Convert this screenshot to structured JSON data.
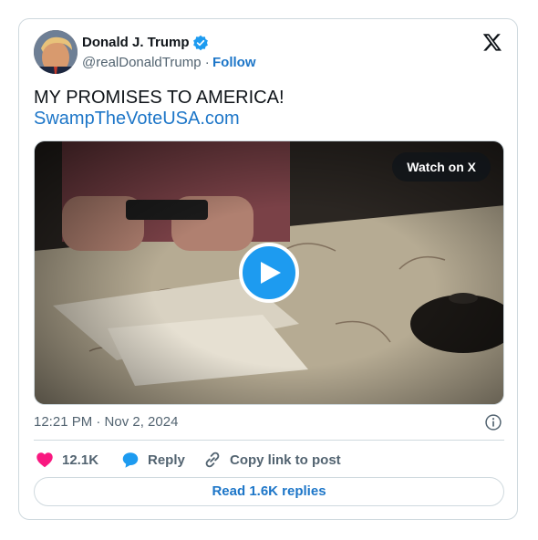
{
  "author": {
    "name": "Donald J. Trump",
    "handle": "@realDonaldTrump",
    "separator": "·",
    "follow_label": "Follow"
  },
  "post": {
    "text": "MY PROMISES TO AMERICA!",
    "link_text": "SwampTheVoteUSA.com",
    "timestamp": "12:21 PM · Nov 2, 2024"
  },
  "media": {
    "watch_label": "Watch on X"
  },
  "actions": {
    "likes": "12.1K",
    "reply_label": "Reply",
    "copy_label": "Copy link to post"
  },
  "footer": {
    "read_replies_label": "Read 1.6K replies"
  },
  "colors": {
    "accent": "#1d9bf0",
    "link": "#1d76c8",
    "like": "#f91880",
    "muted": "#536471",
    "border": "#cfd9de"
  },
  "icons": [
    "verified-badge-icon",
    "x-logo-icon",
    "play-icon",
    "info-icon",
    "heart-icon",
    "reply-bubble-icon",
    "link-icon"
  ]
}
